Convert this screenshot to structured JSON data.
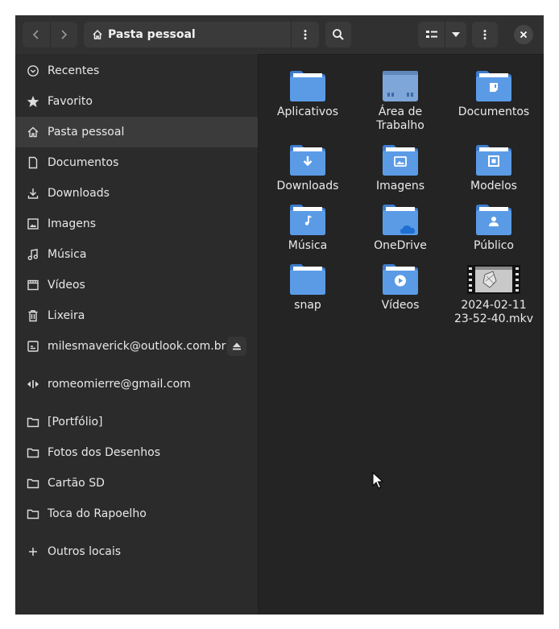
{
  "colors": {
    "folder": "#5b9be6",
    "folder_dark": "#3d7ccc",
    "accent_bg": "#3b3b3b"
  },
  "header": {
    "back_icon": "chevron-left-icon",
    "forward_icon": "chevron-right-icon",
    "location_label": "Pasta pessoal",
    "location_icon": "home-icon",
    "menu_icon": "vertical-dots-icon",
    "search_icon": "search-icon",
    "view_icon": "list-view-icon",
    "view_dropdown_icon": "triangle-down-icon",
    "main_menu_icon": "vertical-dots-icon",
    "close_icon": "close-icon"
  },
  "sidebar": {
    "items": [
      {
        "label": "Recentes",
        "icon": "clock-icon"
      },
      {
        "label": "Favorito",
        "icon": "star-icon"
      },
      {
        "label": "Pasta pessoal",
        "icon": "home-icon"
      },
      {
        "label": "Documentos",
        "icon": "document-icon"
      },
      {
        "label": "Downloads",
        "icon": "download-icon"
      },
      {
        "label": "Imagens",
        "icon": "image-icon"
      },
      {
        "label": "Música",
        "icon": "music-icon"
      },
      {
        "label": "Vídeos",
        "icon": "film-icon"
      },
      {
        "label": "Lixeira",
        "icon": "trash-icon"
      },
      {
        "label": "milesmaverick@outlook.com.br",
        "icon": "online-account-icon"
      },
      {
        "label": "romeomierre@gmail.com",
        "icon": "network-share-icon"
      },
      {
        "label": "[Portfólio]",
        "icon": "folder-icon"
      },
      {
        "label": "Fotos dos Desenhos",
        "icon": "folder-icon"
      },
      {
        "label": "Cartão SD",
        "icon": "folder-icon"
      },
      {
        "label": "Toca do Rapoelho",
        "icon": "folder-icon"
      },
      {
        "label": "Outros locais",
        "icon": "plus-icon"
      }
    ]
  },
  "files": [
    {
      "name": "Aplicativos",
      "kind": "folder",
      "emblem": "none"
    },
    {
      "name": "Área de Trabalho",
      "kind": "desktop-folder",
      "emblem": "none"
    },
    {
      "name": "Documentos",
      "kind": "folder",
      "emblem": "document"
    },
    {
      "name": "Downloads",
      "kind": "folder",
      "emblem": "download"
    },
    {
      "name": "Imagens",
      "kind": "folder",
      "emblem": "image"
    },
    {
      "name": "Modelos",
      "kind": "folder",
      "emblem": "template"
    },
    {
      "name": "Música",
      "kind": "folder",
      "emblem": "music"
    },
    {
      "name": "OneDrive",
      "kind": "folder",
      "emblem": "cloud"
    },
    {
      "name": "Público",
      "kind": "folder",
      "emblem": "person"
    },
    {
      "name": "snap",
      "kind": "folder",
      "emblem": "none"
    },
    {
      "name": "Vídeos",
      "kind": "folder",
      "emblem": "play"
    },
    {
      "name": "2024-02-11 23-52-40.mkv",
      "kind": "video-thumbnail",
      "emblem": "none"
    }
  ]
}
